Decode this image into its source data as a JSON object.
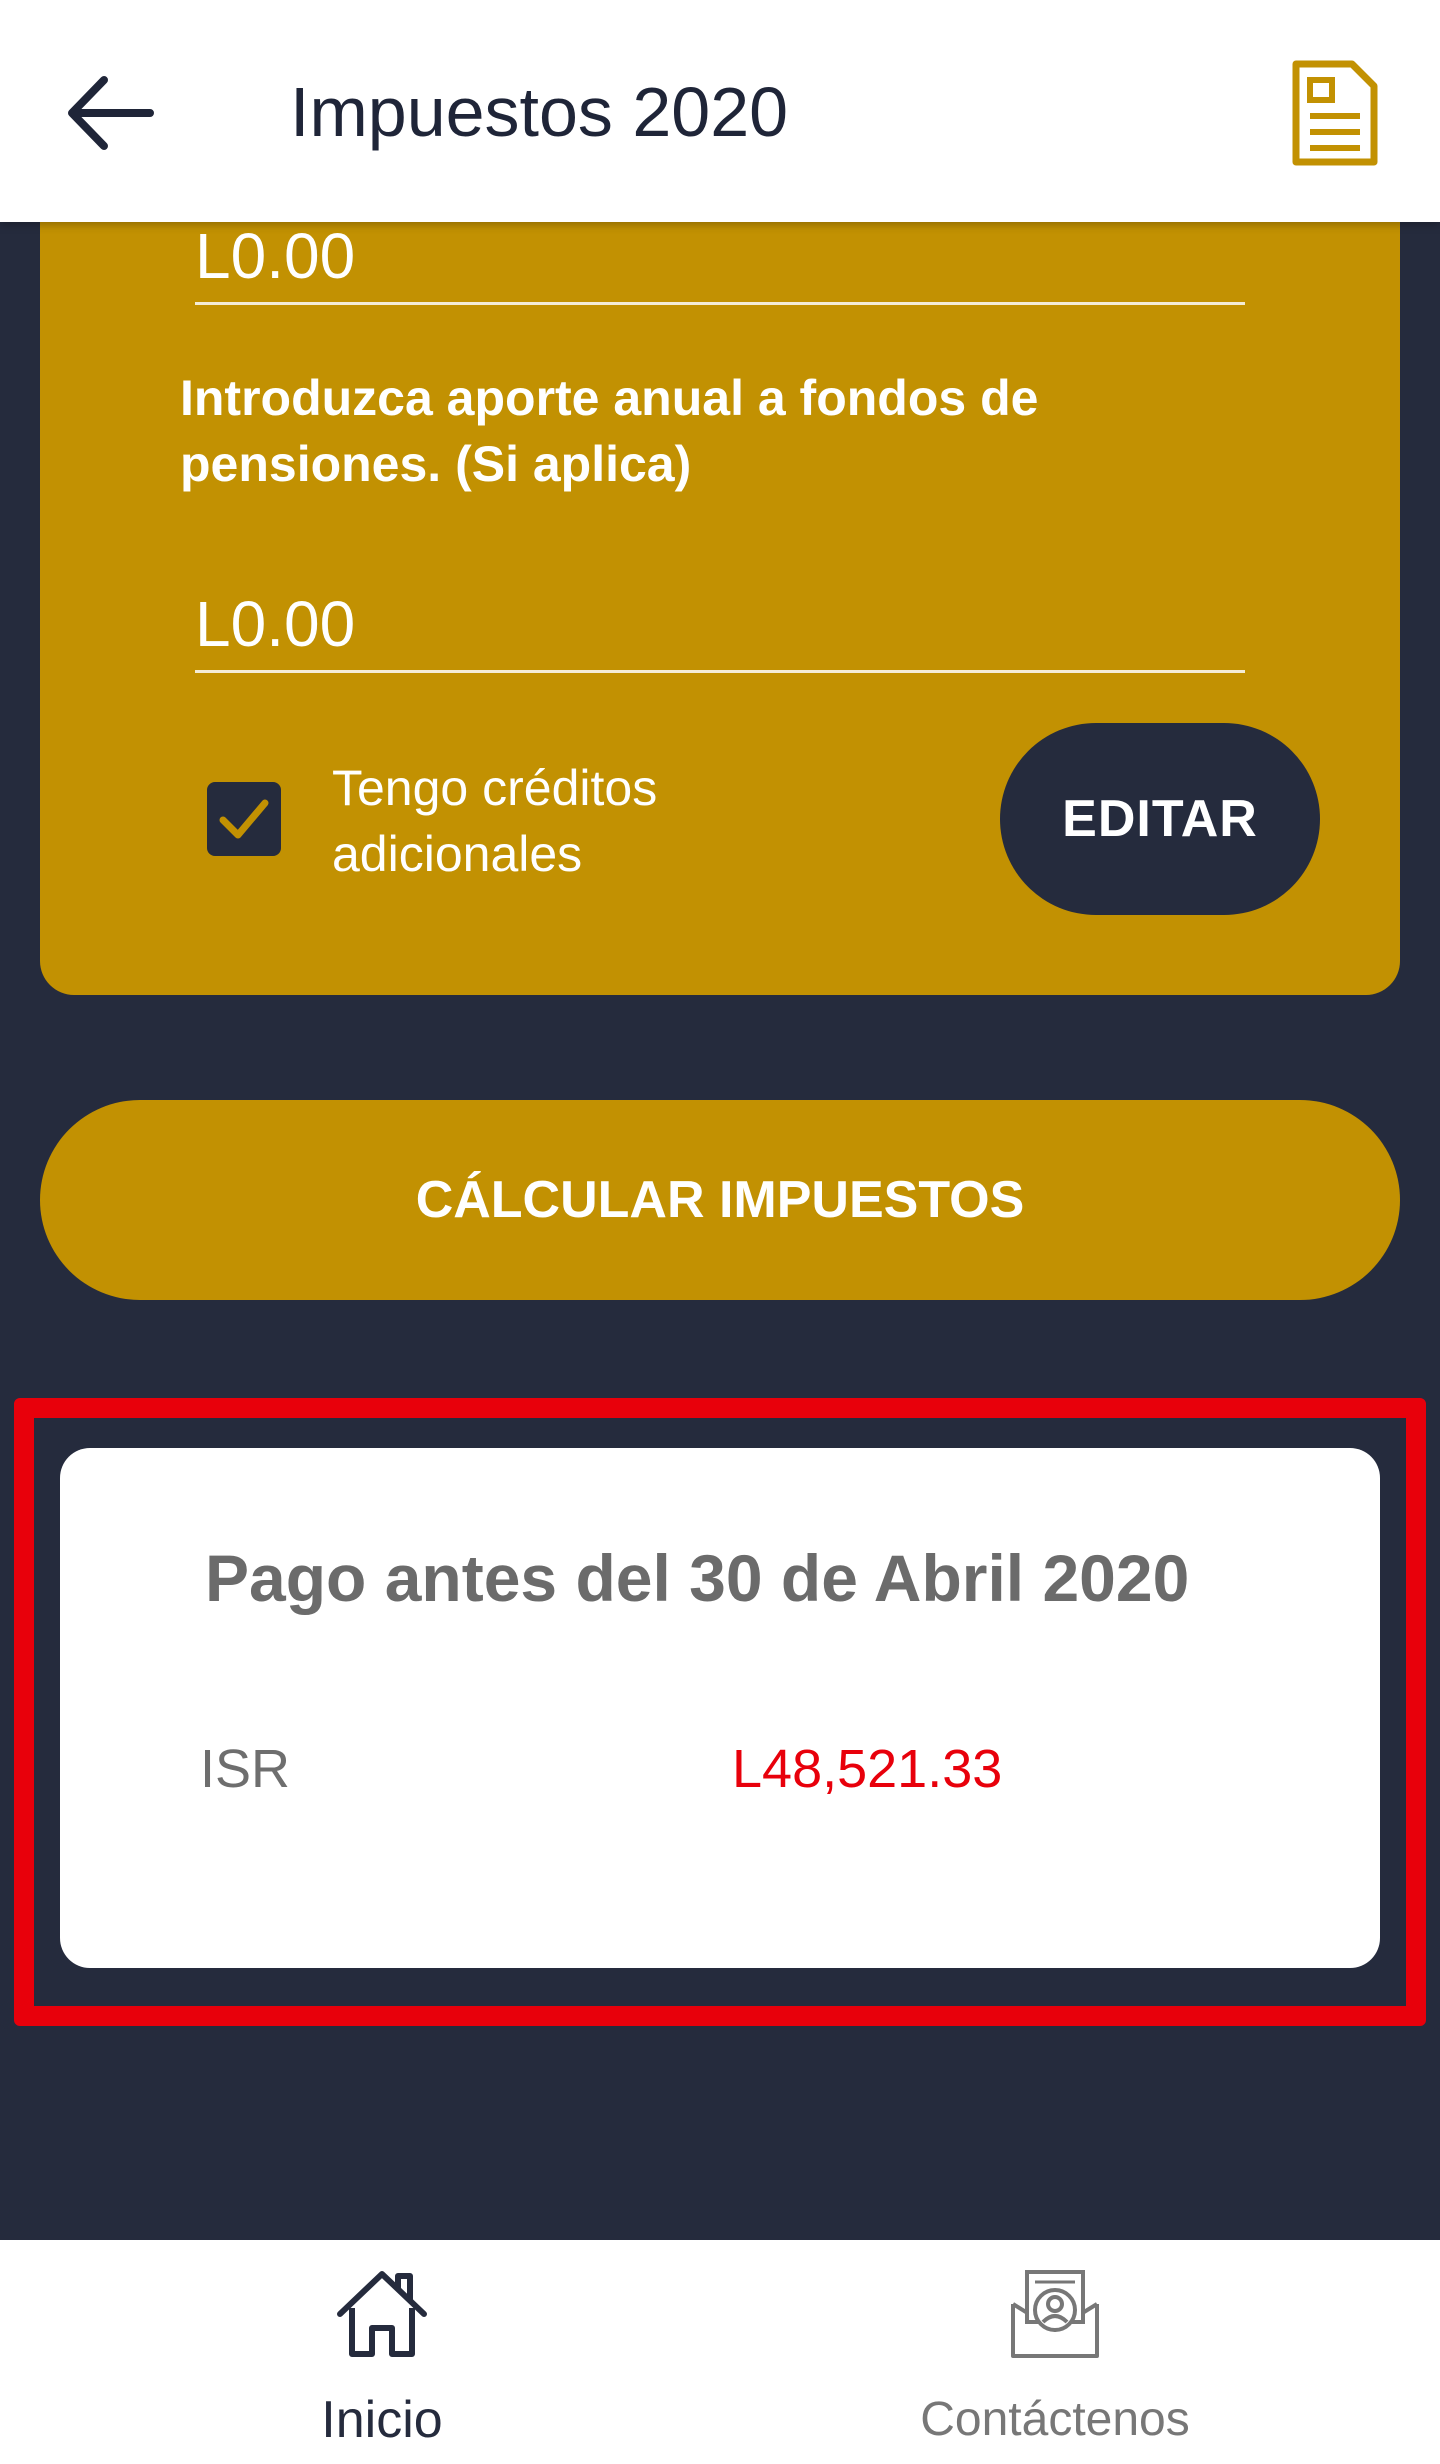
{
  "header": {
    "title": "Impuestos 2020",
    "back_icon": "arrow-left-icon",
    "document_icon": "document-icon"
  },
  "form": {
    "field1_value": "L0.00",
    "pension_prompt": "Introduzca aporte anual a fondos de pensiones. (Si aplica)",
    "pension_value": "L0.00",
    "credits_checked": true,
    "credits_label": "Tengo créditos adicionales",
    "edit_label": "EDITAR"
  },
  "calculate_label": "CÁLCULAR IMPUESTOS",
  "result": {
    "title": "Pago antes del 30 de Abril 2020",
    "isr_label": "ISR",
    "isr_value": "L48,521.33"
  },
  "nav": {
    "home_label": "Inicio",
    "contact_label": "Contáctenos"
  },
  "colors": {
    "gold": "#c29102",
    "navy": "#252b3d",
    "highlight_red": "#e8000b"
  }
}
